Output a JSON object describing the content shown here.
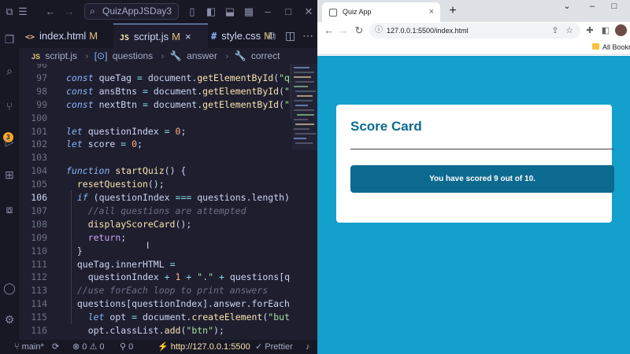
{
  "vscode": {
    "command_center": "QuizAppJSDay3",
    "tabs": [
      {
        "icon": "<>",
        "label": "index.html",
        "modified": "M"
      },
      {
        "icon": "JS",
        "label": "script.js",
        "modified": "M",
        "close": "×"
      },
      {
        "icon": "#",
        "label": "style.css",
        "modified": "M"
      }
    ],
    "breadcrumb": {
      "file_icon": "JS",
      "file": "script.js",
      "items": [
        "questions",
        "answer",
        "correct"
      ]
    },
    "scm_badge": "3",
    "code_lines": [
      {
        "n": "96",
        "text": ""
      },
      {
        "n": "97",
        "text": "const queTag = document.getElementById(\"q"
      },
      {
        "n": "98",
        "text": "const ansBtns = document.getElementById(\""
      },
      {
        "n": "99",
        "text": "const nextBtn = document.getElementById(\""
      },
      {
        "n": "100",
        "text": ""
      },
      {
        "n": "101",
        "text": "let questionIndex = 0;"
      },
      {
        "n": "102",
        "text": "let score = 0;"
      },
      {
        "n": "103",
        "text": ""
      },
      {
        "n": "104",
        "text": "function startQuiz() {"
      },
      {
        "n": "105",
        "text": "  resetQuestion();"
      },
      {
        "n": "106",
        "text": "  if (questionIndex === questions.length)"
      },
      {
        "n": "107",
        "text": "    //all questions are attempted"
      },
      {
        "n": "108",
        "text": "    displayScoreCard();"
      },
      {
        "n": "109",
        "text": "    return;"
      },
      {
        "n": "110",
        "text": "  }"
      },
      {
        "n": "111",
        "text": "  queTag.innerHTML ="
      },
      {
        "n": "112",
        "text": "    questionIndex + 1 + \".\" + questions[q"
      },
      {
        "n": "113",
        "text": "  //use forEach loop to print answers"
      },
      {
        "n": "114",
        "text": "  questions[questionIndex].answer.forEach"
      },
      {
        "n": "115",
        "text": "    let opt = document.createElement(\"but"
      },
      {
        "n": "116",
        "text": "    opt.classList.add(\"btn\");"
      }
    ],
    "status": {
      "branch": "main*",
      "errors": "0",
      "warnings": "0",
      "ports": "0",
      "live_server": "http://127.0.0.1:5500",
      "formatter": "Prettier"
    }
  },
  "browser": {
    "tab_title": "Quiz App",
    "tab_close": "×",
    "new_tab": "+",
    "url": "127.0.0.1:5500/index.html",
    "bookmarks_label": "All Bookm"
  },
  "page": {
    "card_title": "Score Card",
    "score_message": "You have scored 9 out of 10.",
    "colors": {
      "background": "#14a0cc",
      "accent": "#0d6a8f"
    }
  }
}
